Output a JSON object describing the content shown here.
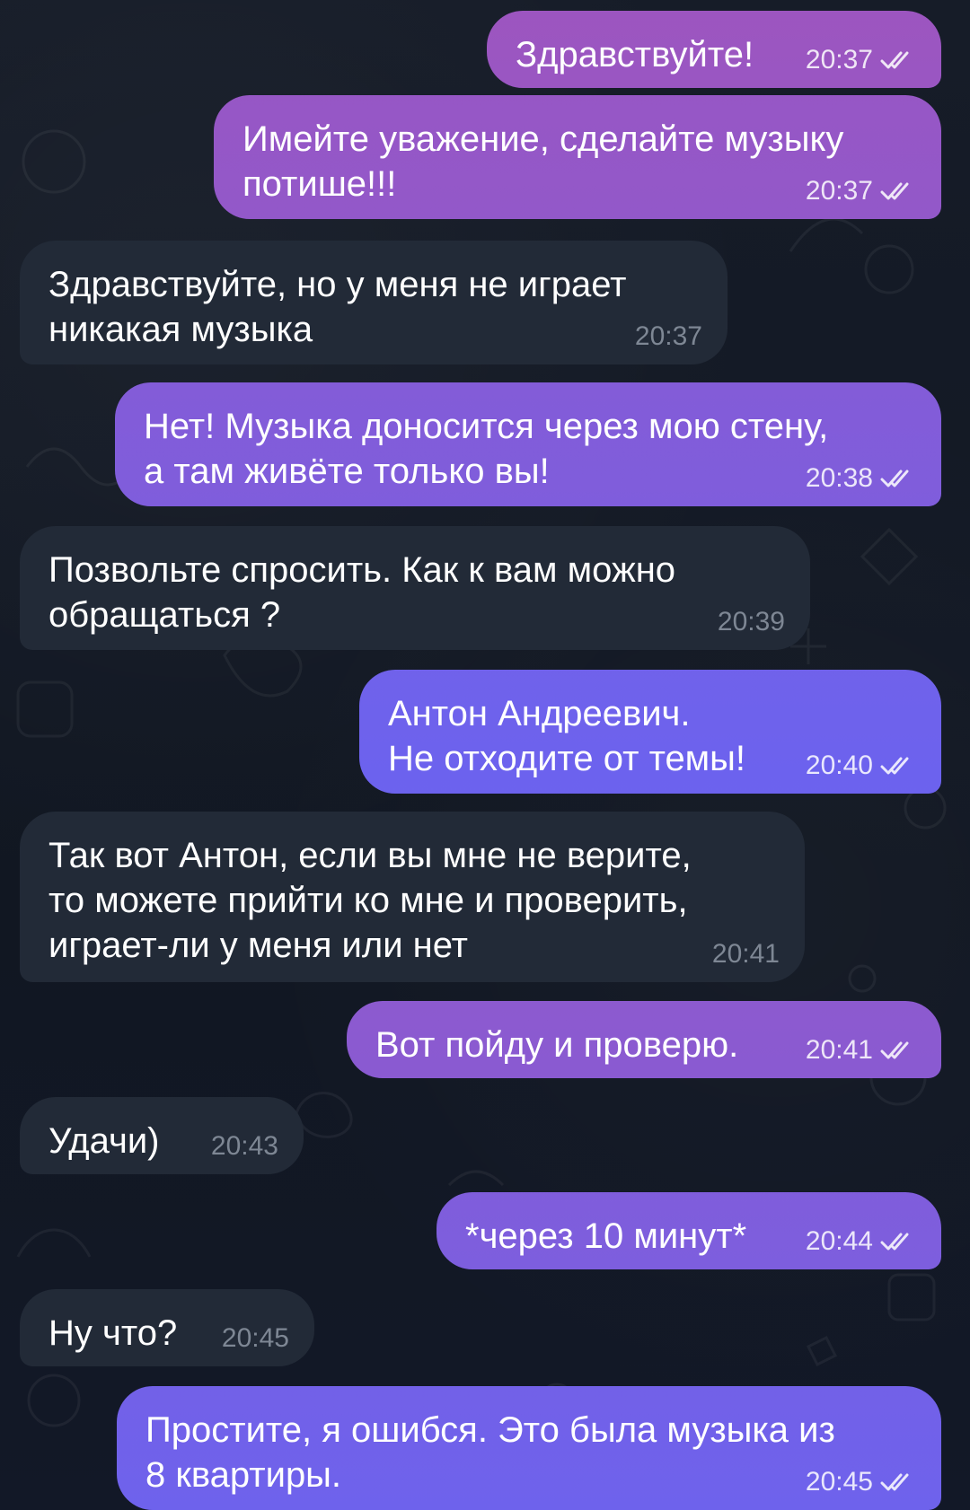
{
  "messages": [
    {
      "dir": "out",
      "text": "Здравствуйте!",
      "time": "20:37",
      "read": true
    },
    {
      "dir": "out",
      "text": "Имейте уважение, сделайте музыку\nпотише!!!",
      "time": "20:37",
      "read": true
    },
    {
      "dir": "in",
      "text": "Здравствуйте, но у меня не играет\nникакая музыка",
      "time": "20:37"
    },
    {
      "dir": "out",
      "text": "Нет! Музыка доносится через мою стену,\nа там живёте только вы!",
      "time": "20:38",
      "read": true
    },
    {
      "dir": "in",
      "text": "Позвольте спросить. Как к вам можно\nобращаться ?",
      "time": "20:39"
    },
    {
      "dir": "out",
      "text": "Антон Андреевич.\nНе отходите от темы!",
      "time": "20:40",
      "read": true
    },
    {
      "dir": "in",
      "text": "Так вот Антон, если вы мне не верите,\nто можете прийти ко мне и проверить,\nиграет-ли у меня или нет",
      "time": "20:41"
    },
    {
      "dir": "out",
      "text": "Вот пойду и проверю.",
      "time": "20:41",
      "read": true
    },
    {
      "dir": "in",
      "text": "Удачи)",
      "time": "20:43"
    },
    {
      "dir": "out",
      "text": "*через 10 минут*",
      "time": "20:44",
      "read": true
    },
    {
      "dir": "in",
      "text": "Ну что?",
      "time": "20:45"
    },
    {
      "dir": "out",
      "text": "Простите, я ошибся. Это была музыка из\n8 квартиры.",
      "time": "20:45",
      "read": true
    }
  ],
  "colors": {
    "background": "#111722",
    "incoming_bubble": "#222a37",
    "outgoing_gradient_top": "#9d55bf",
    "outgoing_gradient_bottom": "#6a63f0"
  },
  "icons": {
    "read_receipt": "double-check-icon"
  }
}
